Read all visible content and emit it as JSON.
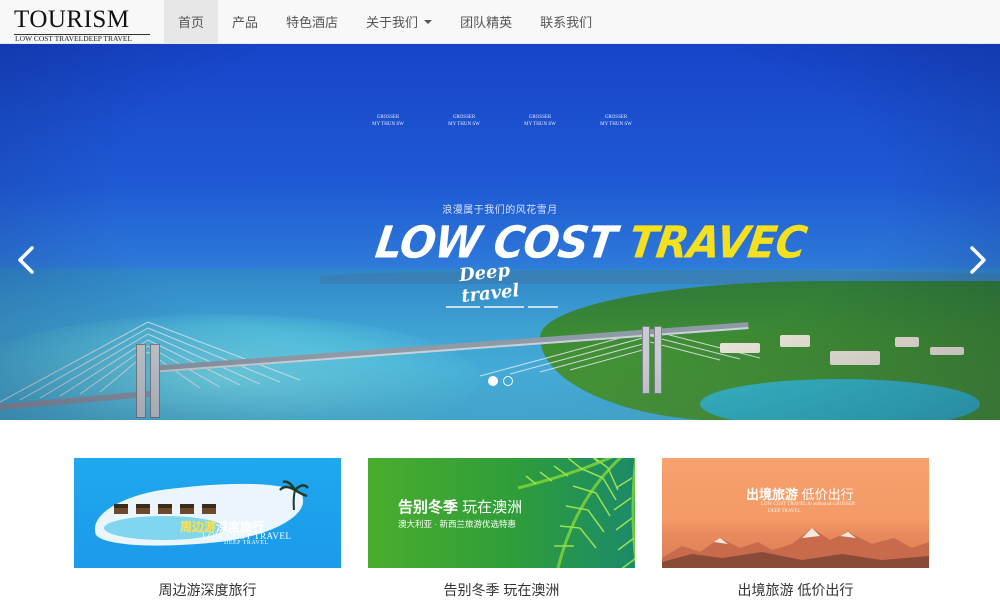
{
  "brand": {
    "title": "TOURISM",
    "subtitle": "LOW COST TRAVELDEEP TRAVEL"
  },
  "nav": {
    "items": [
      {
        "label": "首页",
        "active": true
      },
      {
        "label": "产品",
        "active": false
      },
      {
        "label": "特色酒店",
        "active": false
      },
      {
        "label": "关于我们",
        "active": false,
        "dropdown": true
      },
      {
        "label": "团队精英",
        "active": false
      },
      {
        "label": "联系我们",
        "active": false
      }
    ]
  },
  "hero": {
    "partner_logos": [
      {
        "line1": "GROSSER",
        "line2": "MY THUN SW"
      },
      {
        "line1": "GROSSER",
        "line2": "MY THUN SW"
      },
      {
        "line1": "GROSSER",
        "line2": "MY THUN SW"
      },
      {
        "line1": "GROSSER",
        "line2": "MY THUN SW"
      }
    ],
    "tagline": "浪漫属于我们的风花雪月",
    "title_white": "LOW COST ",
    "title_yellow": "TRAVEC",
    "subtitle": "Deep travel",
    "prev_icon": "chevron-left-icon",
    "next_icon": "chevron-right-icon",
    "slide_count": 2,
    "active_slide": 1
  },
  "cards": [
    {
      "caption": "周边游深度旅行",
      "image": {
        "title_yellow": "周边游",
        "title_white": "深度旅行",
        "en_line1": "LOW COST TRAVEL",
        "en_line2": "DEEP TRAVEL"
      }
    },
    {
      "caption": "告别冬季 玩在澳洲",
      "image": {
        "title_bold": "告别冬季",
        "title_light": " 玩在澳洲",
        "sub": "澳大利亚 · 新西兰旅游优选特惠"
      }
    },
    {
      "caption": "出境旅游 低价出行",
      "image": {
        "title_bold": "出境旅游",
        "title_light": " 低价出行",
        "en_line1": "LOW COST TRAVEL & outbound GROSSER",
        "en_line2": "DEEP TRAVEL"
      }
    }
  ],
  "colors": {
    "navbar_bg": "#f8f8f8",
    "nav_active_bg": "#e7e7e7",
    "hero_blue": "#1744c9",
    "title_yellow": "#f4e01e"
  }
}
